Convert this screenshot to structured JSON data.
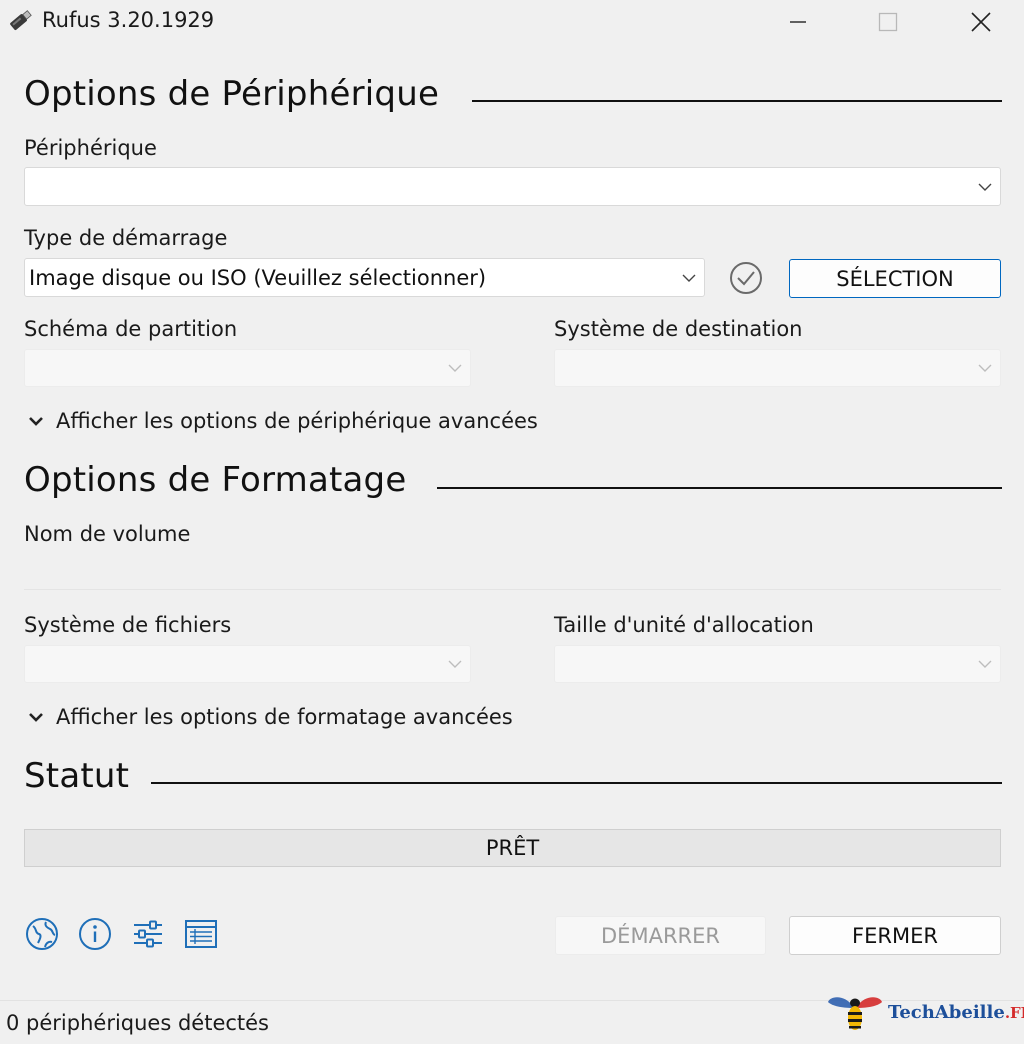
{
  "window": {
    "title": "Rufus 3.20.1929"
  },
  "device_options": {
    "section_title": "Options de Périphérique",
    "device_label": "Périphérique",
    "device_value": "",
    "boot_type_label": "Type de démarrage",
    "boot_type_value": "Image disque ou ISO (Veuillez sélectionner)",
    "select_button": "SÉLECTION",
    "partition_scheme_label": "Schéma de partition",
    "partition_scheme_value": "",
    "target_system_label": "Système de destination",
    "target_system_value": "",
    "advanced_toggle": "Afficher les options de périphérique avancées"
  },
  "format_options": {
    "section_title": "Options de Formatage",
    "volume_label_label": "Nom de volume",
    "volume_label_value": "",
    "file_system_label": "Système de fichiers",
    "file_system_value": "",
    "cluster_size_label": "Taille d'unité d'allocation",
    "cluster_size_value": "",
    "advanced_toggle": "Afficher les options de formatage avancées"
  },
  "status": {
    "section_title": "Statut",
    "progress_text": "PRÊT"
  },
  "actions": {
    "start_button": "DÉMARRER",
    "close_button": "FERMER"
  },
  "toolbar_icons": [
    "globe-icon",
    "info-icon",
    "settings-sliders-icon",
    "log-icon"
  ],
  "footer": {
    "status_text": "0 périphériques détectés"
  },
  "watermark": {
    "brand": "TechAbeille",
    "tld": ".FR"
  },
  "colors": {
    "accent": "#0067c0",
    "icon_blue": "#1f6fb8",
    "brand_blue": "#1d4f9a",
    "brand_red": "#d42a2a"
  }
}
